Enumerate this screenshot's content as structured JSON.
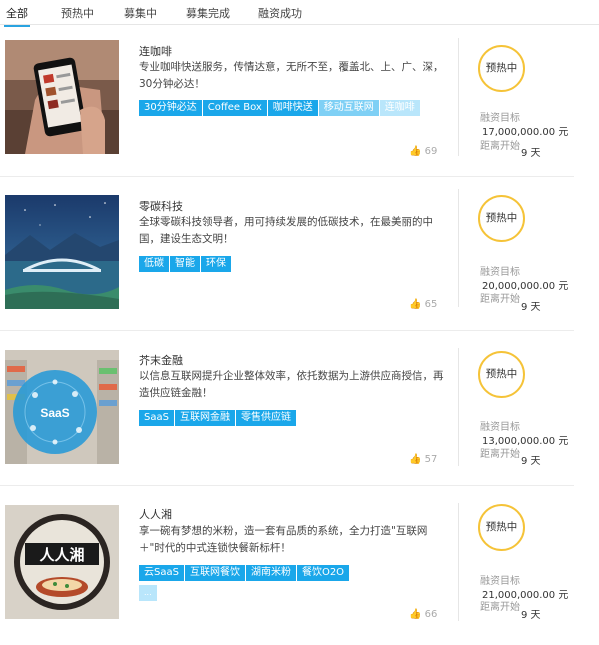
{
  "tabs": [
    {
      "label": "全部"
    },
    {
      "label": "预热中"
    },
    {
      "label": "募集中"
    },
    {
      "label": "募集完成"
    },
    {
      "label": "融资成功"
    }
  ],
  "projects": [
    {
      "name": "连咖啡",
      "desc": "专业咖啡快送服务，传情达意，无所不至，覆盖北、上、广、深，30分钟必达！",
      "tags": [
        "30分钟必达",
        "Coffee Box",
        "咖啡快送",
        "移动互联网",
        "连咖啡"
      ],
      "likes": "69",
      "status": "预热中",
      "target_label": "融资目标",
      "target_value": "17,000,000.00 元",
      "start_label": "距离开始",
      "start_value": "9 天"
    },
    {
      "name": "零碳科技",
      "desc": "全球零碳科技领导者，用可持续发展的低碳技术，在最美丽的中国，建设生态文明！",
      "tags": [
        "低碳",
        "智能",
        "环保"
      ],
      "likes": "65",
      "status": "预热中",
      "target_label": "融资目标",
      "target_value": "20,000,000.00 元",
      "start_label": "距离开始",
      "start_value": "9 天"
    },
    {
      "name": "芥末金融",
      "desc": "以信息互联网提升企业整体效率，依托数据为上游供应商授信，再造供应链金融！",
      "tags": [
        "SaaS",
        "互联网金融",
        "零售供应链"
      ],
      "likes": "57",
      "status": "预热中",
      "target_label": "融资目标",
      "target_value": "13,000,000.00 元",
      "start_label": "距离开始",
      "start_value": "9 天"
    },
    {
      "name": "人人湘",
      "desc": "享一碗有梦想的米粉，造一套有品质的系统，全力打造\"互联网＋\"时代的中式连锁快餐新标杆！",
      "tags": [
        "云SaaS",
        "互联网餐饮",
        "湖南米粉",
        "餐饮O2O"
      ],
      "extra_tag": "...",
      "likes": "66",
      "status": "预热中",
      "target_label": "融资目标",
      "target_value": "21,000,000.00 元",
      "start_label": "距离开始",
      "start_value": "9 天"
    }
  ],
  "thumb_text": {
    "saas": "SaaS",
    "renrenxiang": "人人湘"
  },
  "colors": {
    "tab_accent": "#2aa3e0",
    "tag_blue": "#1aa7ea",
    "status_ring": "#f5c338"
  }
}
